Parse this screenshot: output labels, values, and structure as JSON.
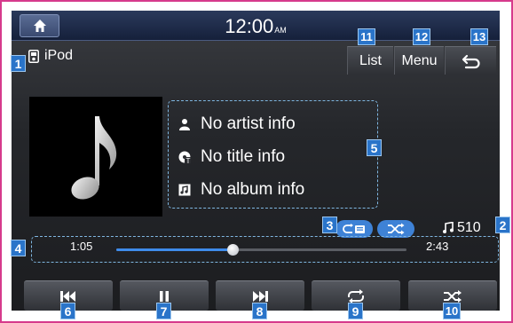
{
  "status_bar": {
    "time": "12:00",
    "ampm": "AM",
    "home_icon": "home-icon"
  },
  "source": {
    "label": "iPod",
    "icon": "ipod-icon"
  },
  "header_buttons": {
    "list_label": "List",
    "menu_label": "Menu",
    "back_icon": "back-arrow-icon"
  },
  "track_info": {
    "artist": "No artist info",
    "title": "No title info",
    "album": "No album info"
  },
  "modes": {
    "repeat_icon": "repeat-category-icon",
    "shuffle_icon": "shuffle-icon"
  },
  "track_count": "510",
  "progress": {
    "elapsed": "1:05",
    "total": "2:43",
    "fraction": 0.4
  },
  "controls": [
    {
      "icon": "previous-icon"
    },
    {
      "icon": "pause-icon"
    },
    {
      "icon": "next-icon"
    },
    {
      "icon": "repeat-icon"
    },
    {
      "icon": "shuffle-icon"
    }
  ],
  "annotations": [
    "1",
    "2",
    "3",
    "4",
    "5",
    "6",
    "7",
    "8",
    "9",
    "10",
    "11",
    "12",
    "13"
  ],
  "colors": {
    "frame_border": "#d63a8c",
    "badge": "#2a74c9",
    "accent": "#3e8bea",
    "text": "#ffffff"
  }
}
